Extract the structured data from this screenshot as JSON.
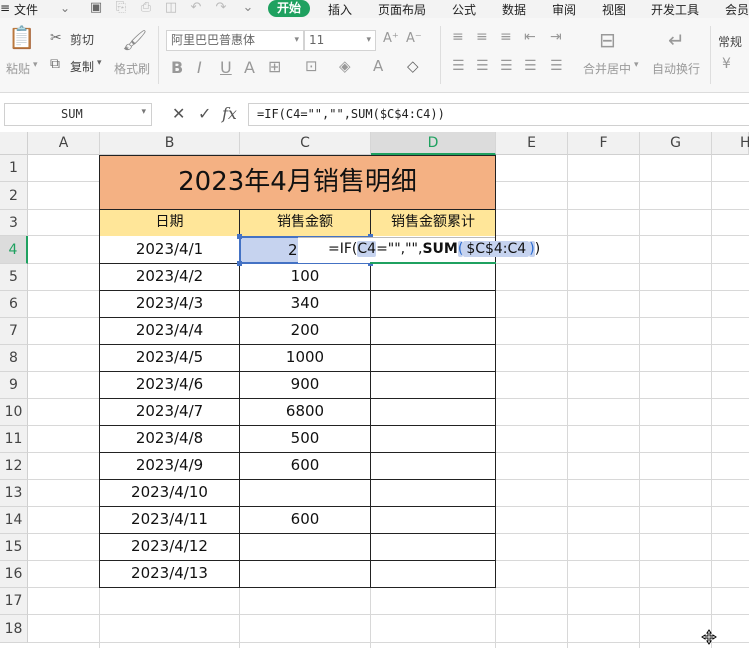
{
  "menu": {
    "file": "文件",
    "tabs": [
      "开始",
      "插入",
      "页面布局",
      "公式",
      "数据",
      "审阅",
      "视图",
      "开发工具",
      "会员"
    ],
    "active_tab": "开始"
  },
  "ribbon": {
    "paste": "粘贴",
    "cut": "剪切",
    "copy": "复制",
    "format_painter": "格式刷",
    "font_name": "阿里巴巴普惠体",
    "font_size": "11",
    "merge_center": "合并居中",
    "auto_wrap": "自动换行",
    "number_format": "常规"
  },
  "formula_bar": {
    "name_box": "SUM",
    "cancel_glyph": "✕",
    "confirm_glyph": "✓",
    "fx_label": "fx",
    "formula": "=IF(C4=\"\",\"\",SUM($C$4:C4))"
  },
  "sheet": {
    "columns": [
      "A",
      "B",
      "C",
      "D",
      "E",
      "F",
      "G",
      "H"
    ],
    "rows": [
      "1",
      "2",
      "3",
      "4",
      "5",
      "6",
      "7",
      "8",
      "9",
      "10",
      "11",
      "12",
      "13",
      "14",
      "15",
      "16",
      "17",
      "18"
    ],
    "selected_column": "D",
    "selected_row": "4",
    "title": "2023年4月销售明细",
    "headers": [
      "日期",
      "销售金额",
      "销售金额累计"
    ],
    "data": [
      {
        "date": "2023/4/1",
        "amount": "2"
      },
      {
        "date": "2023/4/2",
        "amount": "100"
      },
      {
        "date": "2023/4/3",
        "amount": "340"
      },
      {
        "date": "2023/4/4",
        "amount": "200"
      },
      {
        "date": "2023/4/5",
        "amount": "1000"
      },
      {
        "date": "2023/4/6",
        "amount": "900"
      },
      {
        "date": "2023/4/7",
        "amount": "6800"
      },
      {
        "date": "2023/4/8",
        "amount": "500"
      },
      {
        "date": "2023/4/9",
        "amount": "600"
      },
      {
        "date": "2023/4/10",
        "amount": ""
      },
      {
        "date": "2023/4/11",
        "amount": "600"
      },
      {
        "date": "2023/4/12",
        "amount": ""
      },
      {
        "date": "2023/4/13",
        "amount": ""
      }
    ],
    "in_cell_editor": {
      "p1": "=IF(",
      "ref1": "C4",
      "p2": "=\"\",\"\",",
      "fn": "SUM",
      "open": "(",
      "ref2": "$C$4:C4",
      "close": ")",
      "tail": ")"
    }
  },
  "colors": {
    "accent": "#1fa160",
    "title_fill": "#f4b183",
    "header_fill": "#ffe699",
    "selection": "#4472c4"
  }
}
